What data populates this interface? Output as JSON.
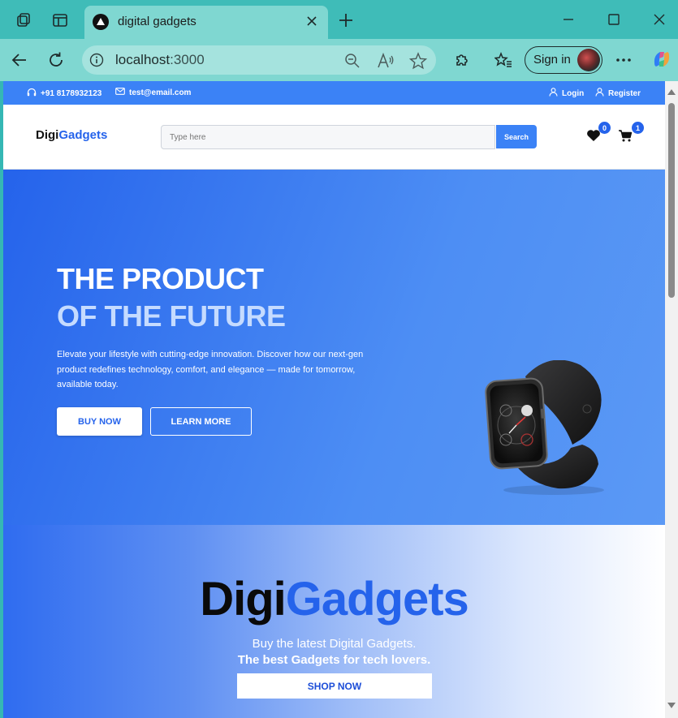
{
  "browser": {
    "tab_title": "digital gadgets",
    "address": "localhost",
    "address_port": ":3000",
    "signin_label": "Sign in"
  },
  "site": {
    "topbar": {
      "phone": "+91 8178932123",
      "email": "test@email.com",
      "login_label": "Login",
      "register_label": "Register"
    },
    "logo": {
      "part1": "Digi",
      "part2": "Gadgets"
    },
    "search": {
      "placeholder": "Type here",
      "button_label": "Search"
    },
    "wishlist_count": "0",
    "cart_count": "1",
    "hero": {
      "title_line1": "THE PRODUCT",
      "title_line2": "OF THE FUTURE",
      "description": "Elevate your lifestyle with cutting-edge innovation. Discover how our next-gen product redefines technology, comfort, and elegance — made for tomorrow, available today.",
      "buy_label": "BUY NOW",
      "learn_label": "LEARN MORE"
    },
    "promo": {
      "title_part1": "Digi",
      "title_part2": "Gadgets",
      "subtitle1": "Buy the latest Digital Gadgets.",
      "subtitle2": "The best Gadgets for tech lovers.",
      "shop_label": "SHOP NOW"
    }
  },
  "colors": {
    "brand_blue": "#2563eb",
    "accent_blue": "#3b82f6",
    "browser_teal": "#3fbcb8"
  }
}
